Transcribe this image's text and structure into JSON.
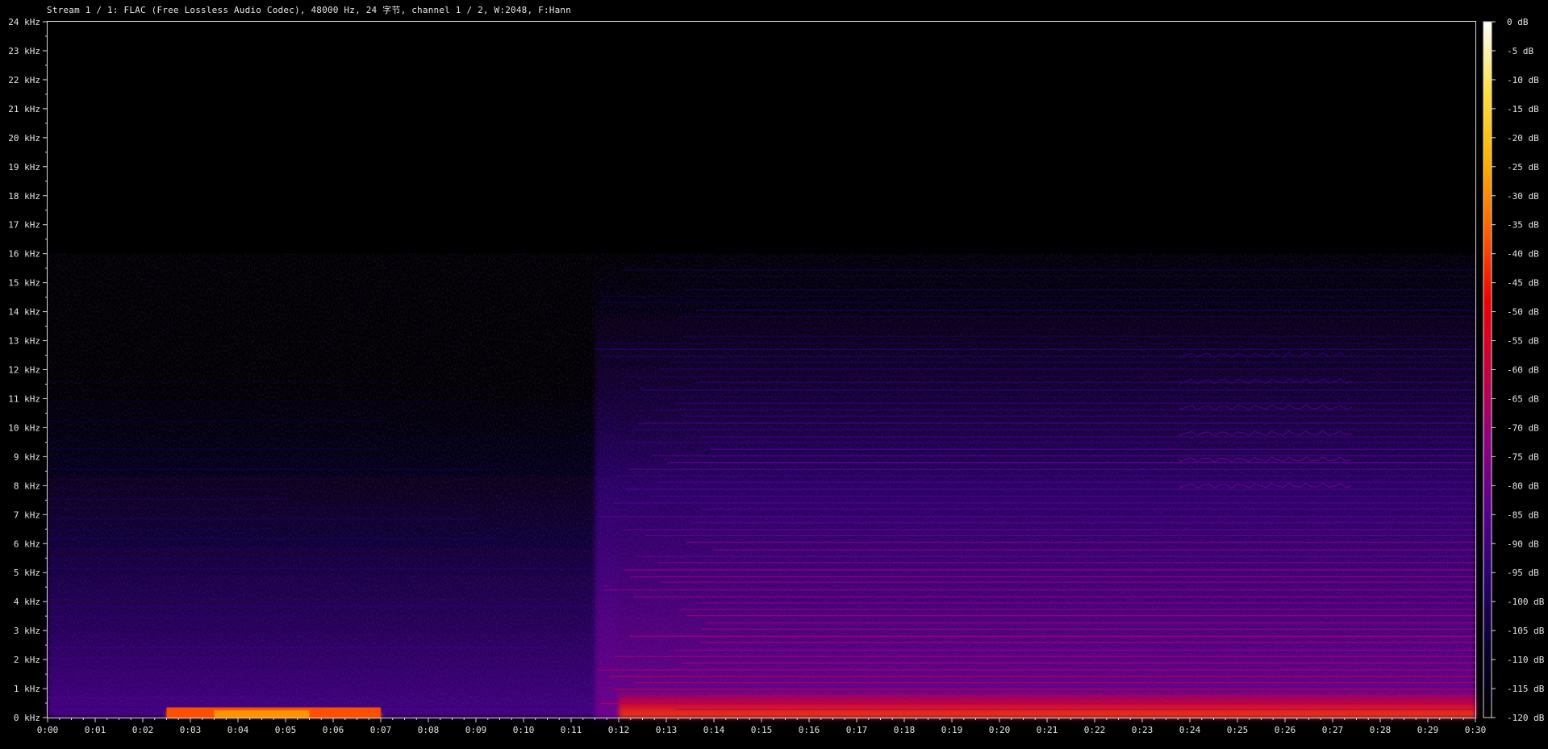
{
  "title": "Stream 1 / 1: FLAC (Free Lossless Audio Codec), 48000 Hz, 24 字节, channel 1 / 2, W:2048, F:Hann",
  "chart_data": {
    "type": "heatmap",
    "title": "Stream 1 / 1: FLAC (Free Lossless Audio Codec), 48000 Hz, 24 字节, channel 1 / 2, W:2048, F:Hann",
    "xlabel": "",
    "ylabel": "",
    "x_unit": "s",
    "y_unit": "kHz",
    "xlim": [
      0,
      30
    ],
    "ylim": [
      0,
      24
    ],
    "x_ticks": [
      "0:00",
      "0:01",
      "0:02",
      "0:03",
      "0:04",
      "0:05",
      "0:06",
      "0:07",
      "0:08",
      "0:09",
      "0:10",
      "0:11",
      "0:12",
      "0:13",
      "0:14",
      "0:15",
      "0:16",
      "0:17",
      "0:18",
      "0:19",
      "0:20",
      "0:21",
      "0:22",
      "0:23",
      "0:24",
      "0:25",
      "0:26",
      "0:27",
      "0:28",
      "0:29",
      "0:30"
    ],
    "y_ticks": [
      "0 kHz",
      "1 kHz",
      "2 kHz",
      "3 kHz",
      "4 kHz",
      "5 kHz",
      "6 kHz",
      "7 kHz",
      "8 kHz",
      "9 kHz",
      "10 kHz",
      "11 kHz",
      "12 kHz",
      "13 kHz",
      "14 kHz",
      "15 kHz",
      "16 kHz",
      "17 kHz",
      "18 kHz",
      "19 kHz",
      "20 kHz",
      "21 kHz",
      "22 kHz",
      "23 kHz",
      "24 kHz"
    ],
    "colorbar": {
      "range_db": [
        -120,
        0
      ],
      "ticks": [
        "0 dB",
        "-5 dB",
        "-10 dB",
        "-15 dB",
        "-20 dB",
        "-25 dB",
        "-30 dB",
        "-35 dB",
        "-40 dB",
        "-45 dB",
        "-50 dB",
        "-55 dB",
        "-60 dB",
        "-65 dB",
        "-70 dB",
        "-75 dB",
        "-80 dB",
        "-85 dB",
        "-90 dB",
        "-95 dB",
        "-100 dB",
        "-105 dB",
        "-110 dB",
        "-115 dB",
        "-120 dB"
      ],
      "colors": [
        "#000000",
        "#0a0030",
        "#2a0070",
        "#5a0090",
        "#900080",
        "#c80040",
        "#f00000",
        "#ff6000",
        "#ffb000",
        "#ffe040",
        "#ffffff"
      ]
    },
    "grid": false,
    "energy_regions": [
      {
        "t_start": 0,
        "t_end": 12,
        "f_low_khz": 0,
        "f_high_khz": 12,
        "level_db": -105
      },
      {
        "t_start": 2.5,
        "t_end": 7,
        "f_low_khz": 0,
        "f_high_khz": 0.3,
        "level_db": -40
      },
      {
        "t_start": 11.5,
        "t_end": 30,
        "f_low_khz": 0,
        "f_high_khz": 16,
        "level_db": -95
      },
      {
        "t_start": 12,
        "t_end": 30,
        "f_low_khz": 0,
        "f_high_khz": 1,
        "level_db": -55
      }
    ]
  }
}
